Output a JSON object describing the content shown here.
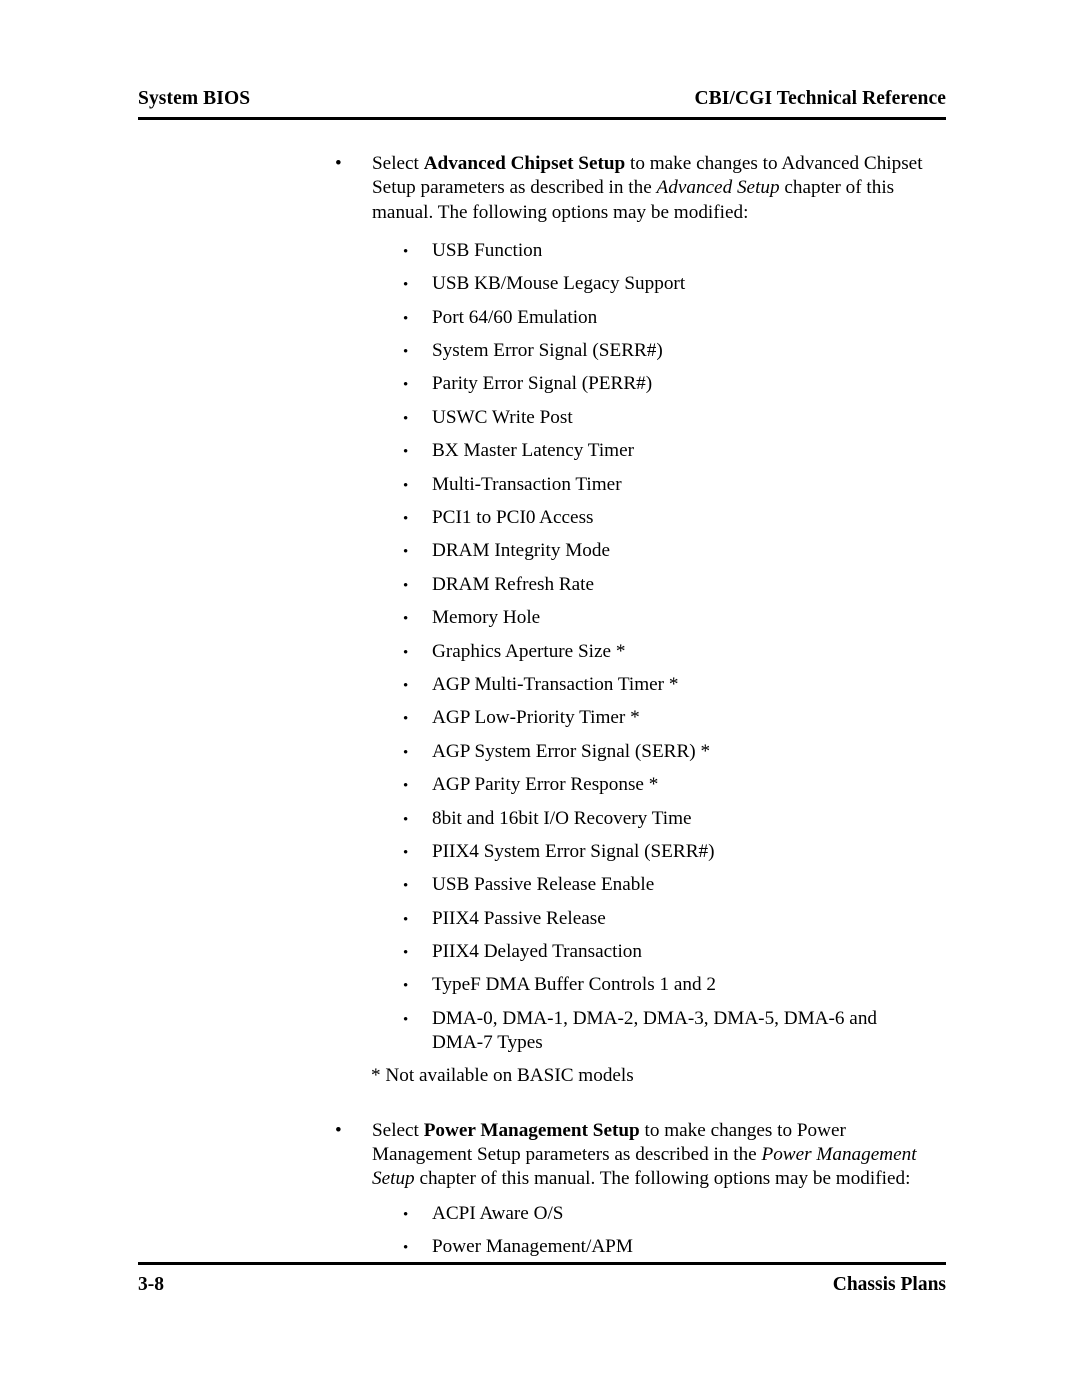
{
  "header": {
    "left": "System BIOS",
    "right": "CBI/CGI Technical Reference"
  },
  "footer": {
    "left": "3-8",
    "right": "Chassis Plans"
  },
  "bullet_glyph": "•",
  "sections": [
    {
      "intro": {
        "lead": "Select ",
        "bold": "Advanced Chipset Setup",
        "mid": " to make changes to Advanced Chipset Setup parameters as described in the ",
        "italic": "Advanced Setup",
        "tail": " chapter of this manual.  The following options may be modified:"
      },
      "options": [
        "USB Function",
        "USB KB/Mouse Legacy Support",
        "Port 64/60 Emulation",
        "System Error Signal (SERR#)",
        "Parity Error Signal (PERR#)",
        "USWC Write Post",
        "BX Master Latency Timer",
        "Multi-Transaction Timer",
        "PCI1 to PCI0 Access",
        "DRAM Integrity Mode",
        "DRAM Refresh Rate",
        "Memory Hole",
        "Graphics Aperture Size *",
        "AGP Multi-Transaction Timer *",
        "AGP Low-Priority Timer *",
        "AGP System Error Signal (SERR) *",
        "AGP Parity Error Response *",
        "8bit and 16bit I/O Recovery Time",
        "PIIX4 System Error Signal (SERR#)",
        "USB Passive Release Enable",
        "PIIX4 Passive Release",
        "PIIX4 Delayed Transaction",
        "TypeF DMA Buffer Controls 1 and 2",
        "DMA-0, DMA-1, DMA-2, DMA-3, DMA-5, DMA-6 and DMA-7 Types"
      ],
      "footnote": "* Not available on BASIC models"
    },
    {
      "intro": {
        "lead": "Select ",
        "bold": "Power Management Setup",
        "mid": " to make changes to Power Management Setup parameters as described in the ",
        "italic": "Power Management Setup",
        "tail": " chapter of this manual.  The following options may be modified:"
      },
      "options": [
        "ACPI Aware O/S",
        "Power Management/APM"
      ]
    }
  ]
}
